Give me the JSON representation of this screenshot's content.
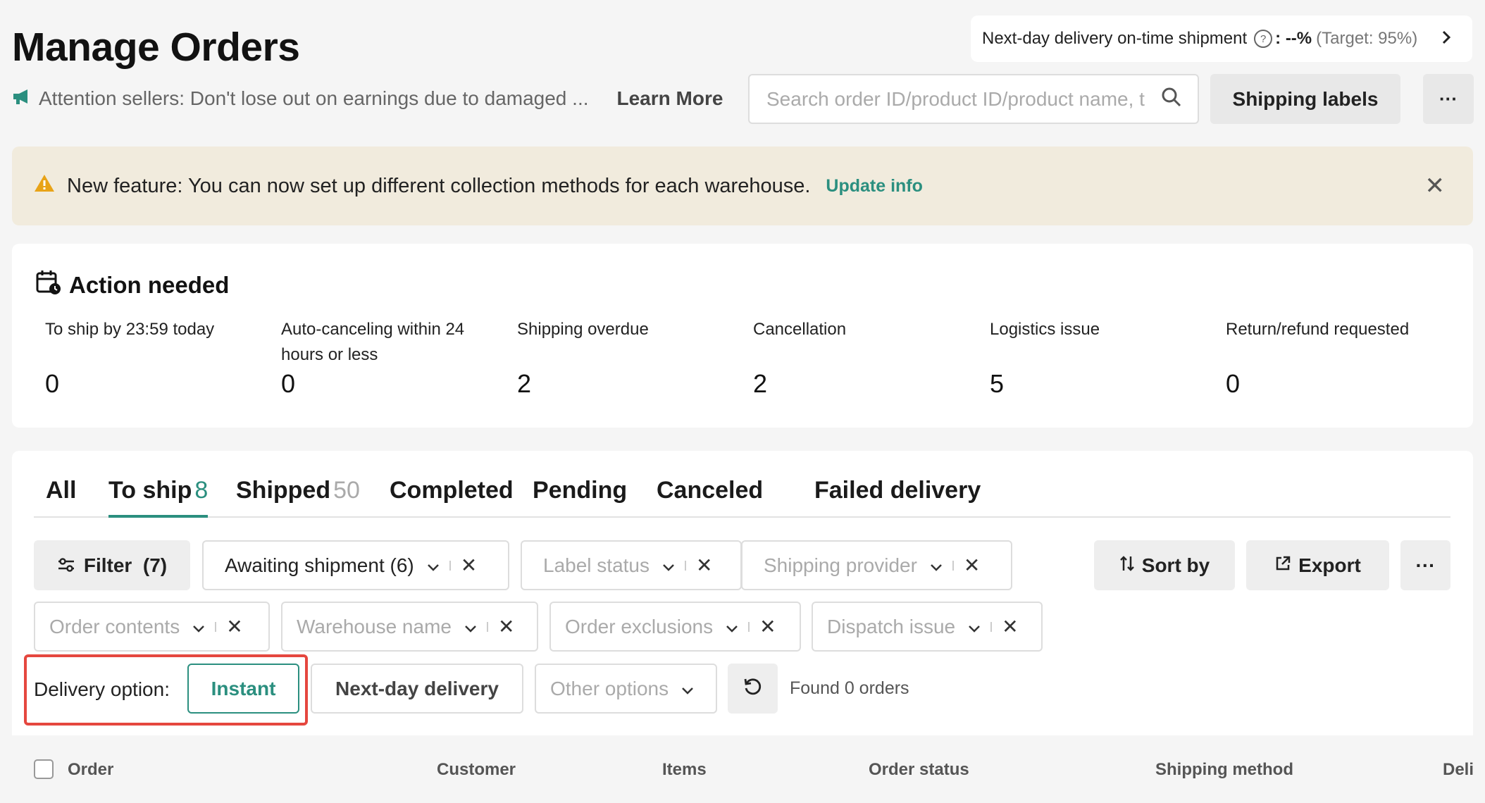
{
  "header": {
    "title": "Manage Orders",
    "notice_text": "Attention sellers: Don't lose out on earnings due to damaged ...",
    "learn_more": "Learn More",
    "metric_label": "Next-day delivery on-time shipment",
    "metric_help": "?",
    "metric_value": ": --%",
    "metric_target": "(Target: 95%)",
    "search_placeholder": "Search order ID/product ID/product name, t",
    "shipping_labels": "Shipping labels",
    "more": "···"
  },
  "banner": {
    "text": "New feature: You can now set up different collection methods for each warehouse.",
    "link": "Update info",
    "close": "✕"
  },
  "action_needed": {
    "title": "Action needed",
    "items": [
      {
        "label": "To ship by 23:59 today",
        "value": "0"
      },
      {
        "label": "Auto-canceling within 24 hours or less",
        "value": "0"
      },
      {
        "label": "Shipping overdue",
        "value": "2"
      },
      {
        "label": "Cancellation",
        "value": "2"
      },
      {
        "label": "Logistics issue",
        "value": "5"
      },
      {
        "label": "Return/refund requested",
        "value": "0"
      }
    ]
  },
  "tabs": [
    {
      "label": "All",
      "count": ""
    },
    {
      "label": "To ship",
      "count": "8"
    },
    {
      "label": "Shipped",
      "count": "50"
    },
    {
      "label": "Completed",
      "count": ""
    },
    {
      "label": "Pending",
      "count": ""
    },
    {
      "label": "Canceled",
      "count": ""
    },
    {
      "label": "Failed delivery",
      "count": ""
    }
  ],
  "filters": {
    "filter_button": "Filter  (7)",
    "awaiting": "Awaiting shipment (6)",
    "label_status": "Label status",
    "shipping_provider": "Shipping provider",
    "order_contents": "Order contents",
    "warehouse_name": "Warehouse name",
    "order_exclusions": "Order exclusions",
    "dispatch_issue": "Dispatch issue",
    "sort_by": "Sort by",
    "export": "Export",
    "more": "···",
    "x": "✕"
  },
  "delivery": {
    "label": "Delivery option:",
    "instant": "Instant",
    "next_day": "Next-day delivery",
    "other": "Other options",
    "found": "Found 0 orders"
  },
  "table": {
    "headers": [
      "Order",
      "Customer",
      "Items",
      "Order status",
      "Shipping method",
      "Deli"
    ]
  },
  "colors": {
    "accent": "#2b8f7f",
    "highlight_border": "#e5473f",
    "banner_bg": "#f1ebdd",
    "warning_icon": "#e8a317"
  }
}
